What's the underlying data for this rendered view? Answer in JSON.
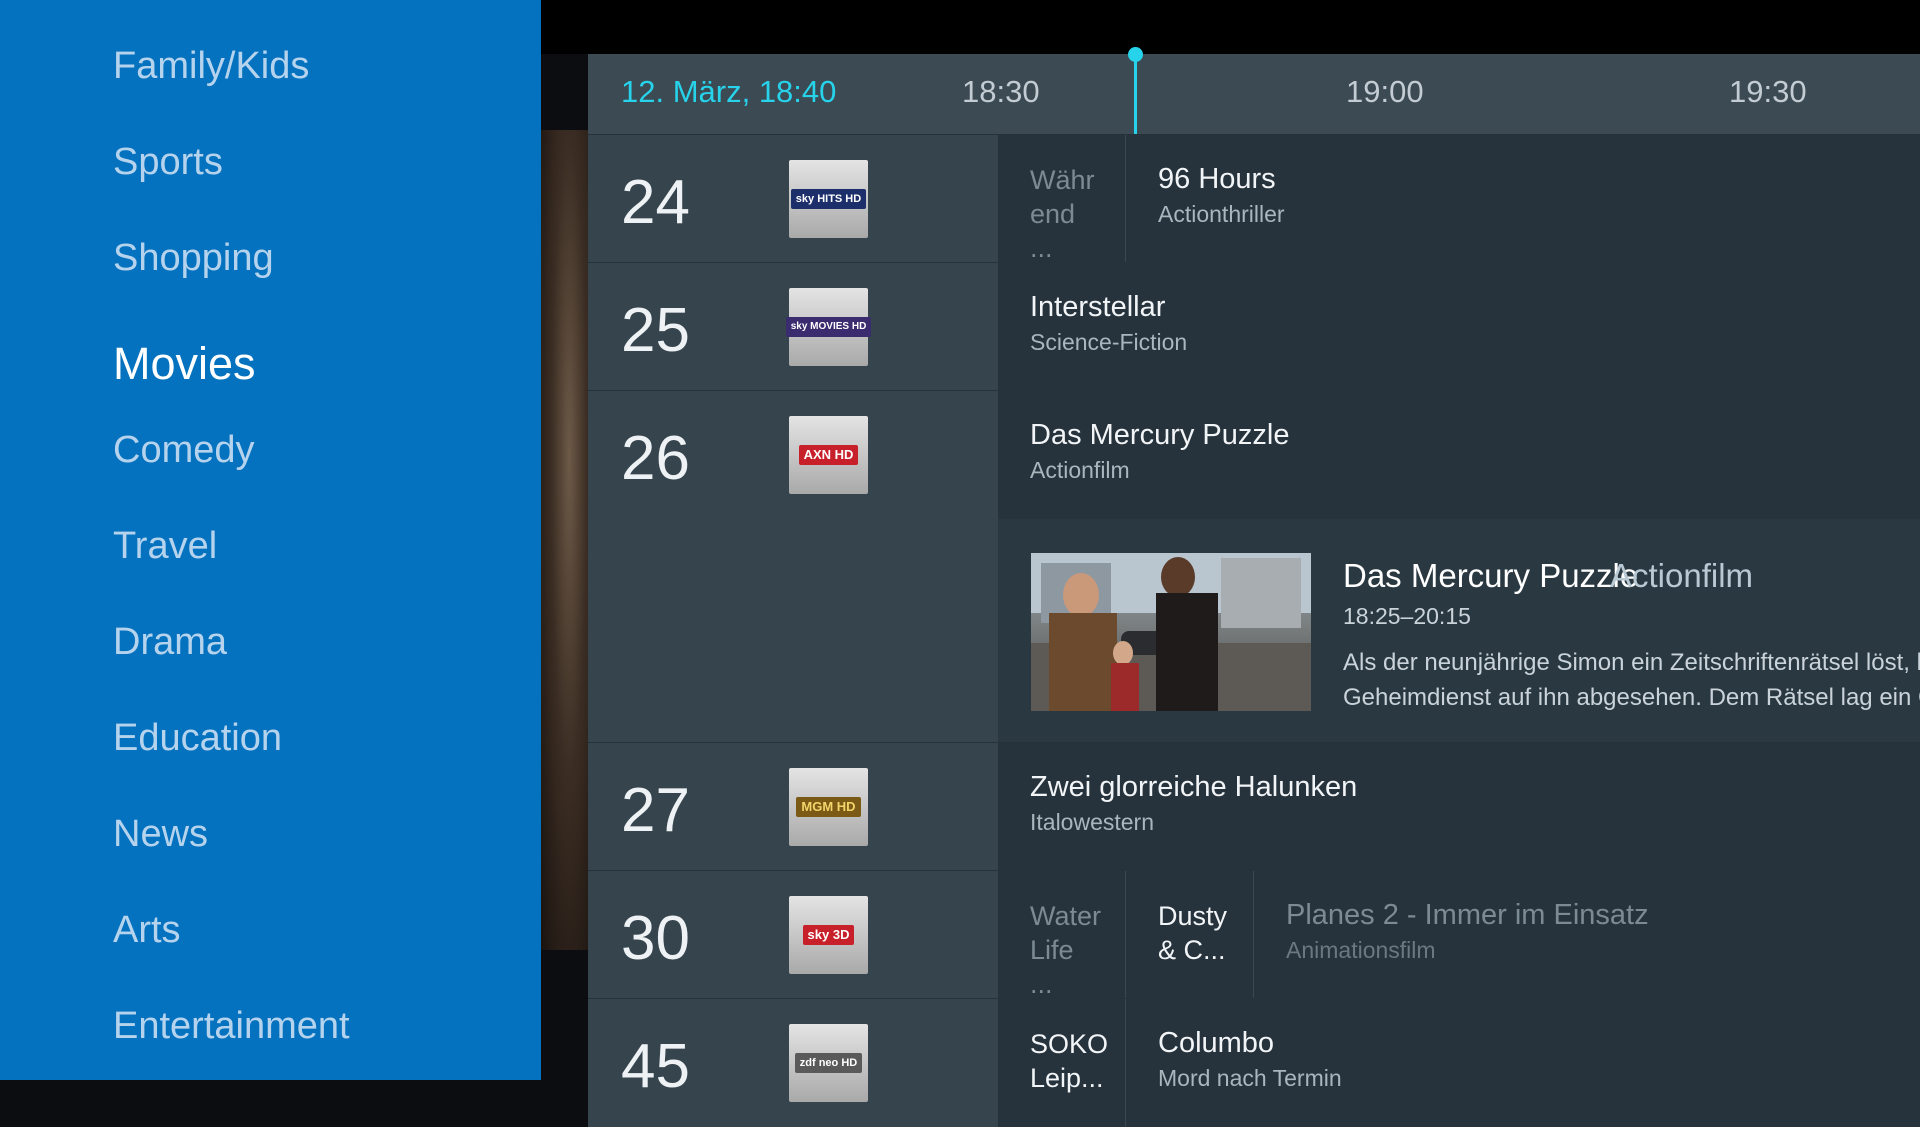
{
  "sidebar": {
    "categories": [
      "Family/Kids",
      "Sports",
      "Shopping",
      "Movies",
      "Comedy",
      "Travel",
      "Drama",
      "Education",
      "News",
      "Arts",
      "Entertainment"
    ],
    "active": "Movies"
  },
  "guide": {
    "date": "12. März, 18:40",
    "times": [
      "18:30",
      "19:00",
      "19:30"
    ]
  },
  "channels": [
    {
      "number": "24",
      "logo": "sky HITS HD",
      "programs": [
        {
          "small": "Währ\nend ..."
        },
        {
          "title": "96 Hours",
          "genre": "Actionthriller"
        }
      ]
    },
    {
      "number": "25",
      "logo": "sky MOVIES HD",
      "programs": [
        {
          "title": "Interstellar",
          "genre": "Science-Fiction"
        }
      ]
    },
    {
      "number": "26",
      "logo": "AXN HD",
      "programs": [
        {
          "title": "Das Mercury Puzzle",
          "genre": "Actionfilm"
        }
      ]
    },
    {
      "number": "27",
      "logo": "MGM HD",
      "programs": [
        {
          "title": "Zwei glorreiche Halunken",
          "genre": "Italowestern"
        }
      ]
    },
    {
      "number": "30",
      "logo": "sky 3D",
      "programs": [
        {
          "small": "Water\nLife ..."
        },
        {
          "small": "Dusty\n& C..."
        },
        {
          "title": "Planes 2 - Immer im Einsatz",
          "genre": "Animationsfilm"
        }
      ]
    },
    {
      "number": "45",
      "logo": "zdf neo HD",
      "programs": [
        {
          "small": "SOKO\nLeip..."
        },
        {
          "title": "Columbo",
          "genre": "Mord nach Termin"
        }
      ]
    }
  ],
  "detail": {
    "title": "Das Mercury Puzzle",
    "genre": "Actionfilm",
    "time": "18:25–20:15",
    "desc1": "Als der neunjährige Simon ein Zeitschriftenrätsel löst, l",
    "desc2": "Geheimdienst auf ihn abgesehen. Dem Rätsel lag ein G"
  },
  "colors": {
    "sidebar": "#0472be",
    "accent": "#27d3ea",
    "guide": "#2f3c45"
  }
}
